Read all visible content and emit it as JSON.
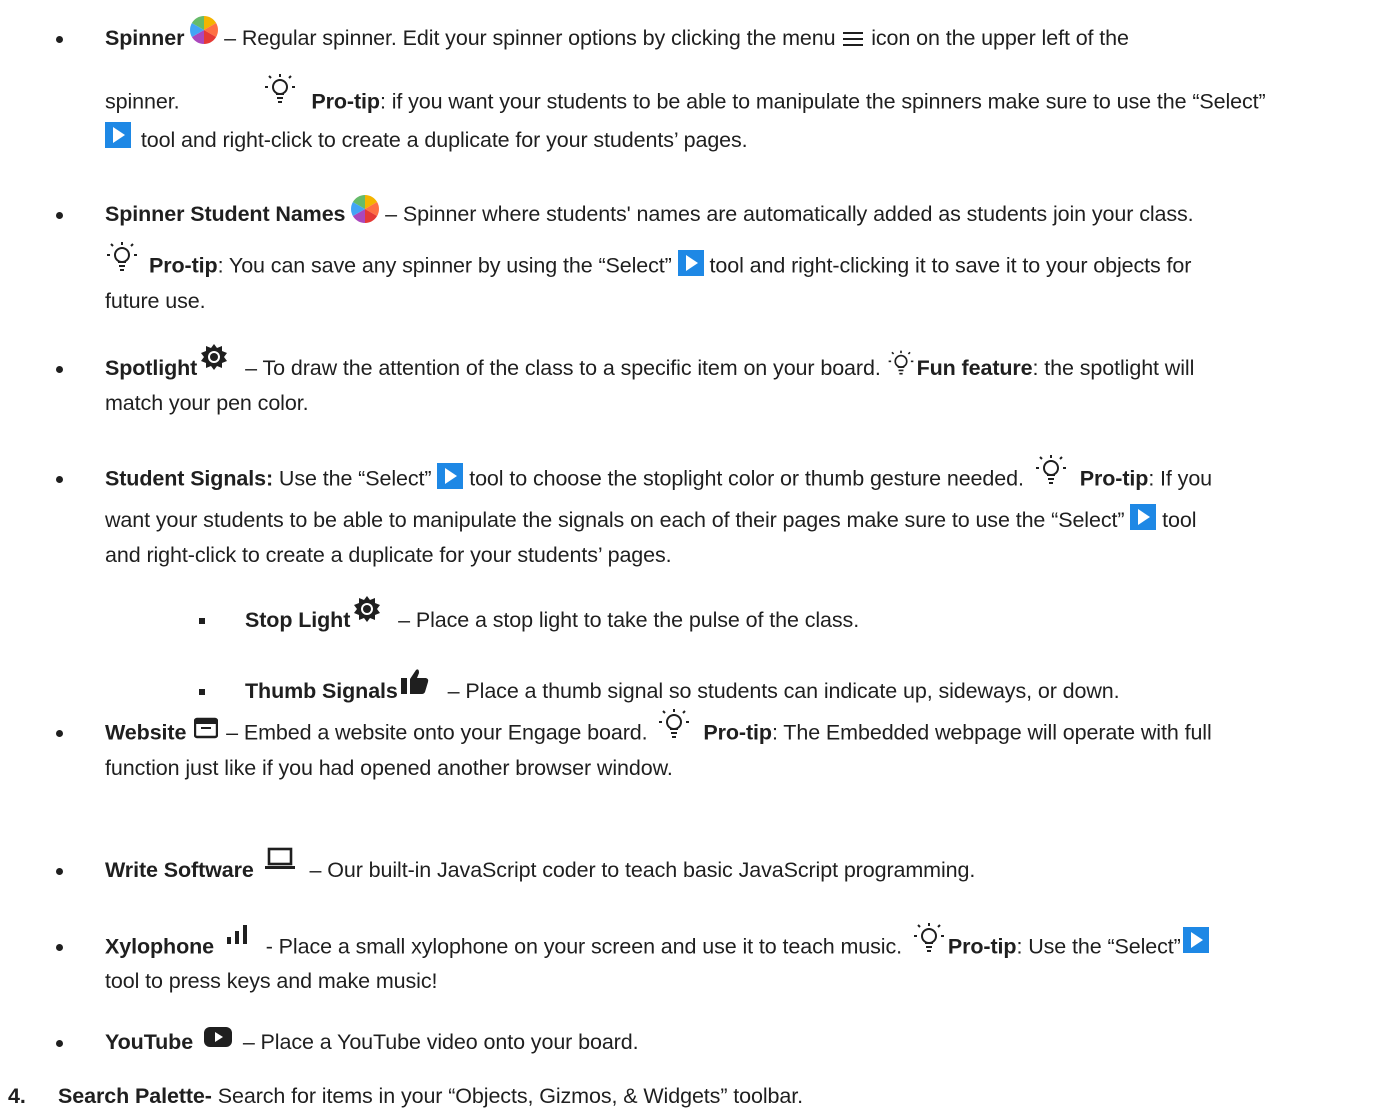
{
  "items": {
    "spinner": {
      "title": "Spinner",
      "t1": " – Regular spinner. Edit your spinner options by clicking the menu ",
      "t2": " icon on the upper left of the",
      "t3": "spinner. ",
      "pro": "Pro-tip",
      "t4": ": if you want your students to be able to manipulate the spinners make sure to use the “Select”",
      "t5": " tool and right-click to create a duplicate for your students’ pages."
    },
    "spinner_names": {
      "title": "Spinner Student Names",
      "t1": " – Spinner where students' names are automatically added as students join your class.",
      "pro": "Pro-tip",
      "t2": ": You can save any spinner by using the “Select” ",
      "t3": " tool and right-clicking it to save it to your objects for",
      "t4": "future use."
    },
    "spotlight": {
      "title": "Spotlight",
      "t1": " – To draw the attention of the class to a specific item on your board. ",
      "fun": "Fun feature",
      "t2": ": the spotlight will",
      "t3": "match your pen color."
    },
    "signals": {
      "title": "Student Signals:",
      "t1": " Use the “Select” ",
      "t2": " tool to choose the stoplight color or thumb gesture needed. ",
      "pro": "Pro-tip",
      "t3": ": If you",
      "t4": "want your students to be able to manipulate the signals on each of their pages make sure to use the “Select” ",
      "t5": " tool",
      "t6": "and right-click to create a duplicate for your students’ pages."
    },
    "stoplight": {
      "title": "Stop Light",
      "t1": " – Place a stop light to take the pulse of the class."
    },
    "thumb": {
      "title": "Thumb Signals",
      "t1": " – Place a thumb signal so students can indicate up, sideways, or down."
    },
    "website": {
      "title": "Website",
      "t1": " – Embed a website onto your Engage board. ",
      "pro": "Pro-tip",
      "t2": ": The Embedded webpage will operate with full",
      "t3": "function just like if you had opened another browser window."
    },
    "write_software": {
      "title": "Write Software",
      "t1": " – Our built-in JavaScript coder to teach basic JavaScript programming."
    },
    "xylophone": {
      "title": "Xylophone",
      "t1": " - Place a small xylophone on your screen and use it to teach music. ",
      "pro": "Pro-tip",
      "t2": ": Use the “Select”",
      "t3": "tool to press keys and make music!"
    },
    "youtube": {
      "title": "YouTube",
      "t1": " – Place a YouTube video onto your board."
    }
  },
  "numbered": {
    "number": "4.",
    "title": "Search Palette-",
    "t1": " Search for items in your “Objects, Gizmos, & Widgets” toolbar."
  },
  "colors": {
    "select_icon_bg": "#1e88e5",
    "text": "#1f1f1f"
  }
}
